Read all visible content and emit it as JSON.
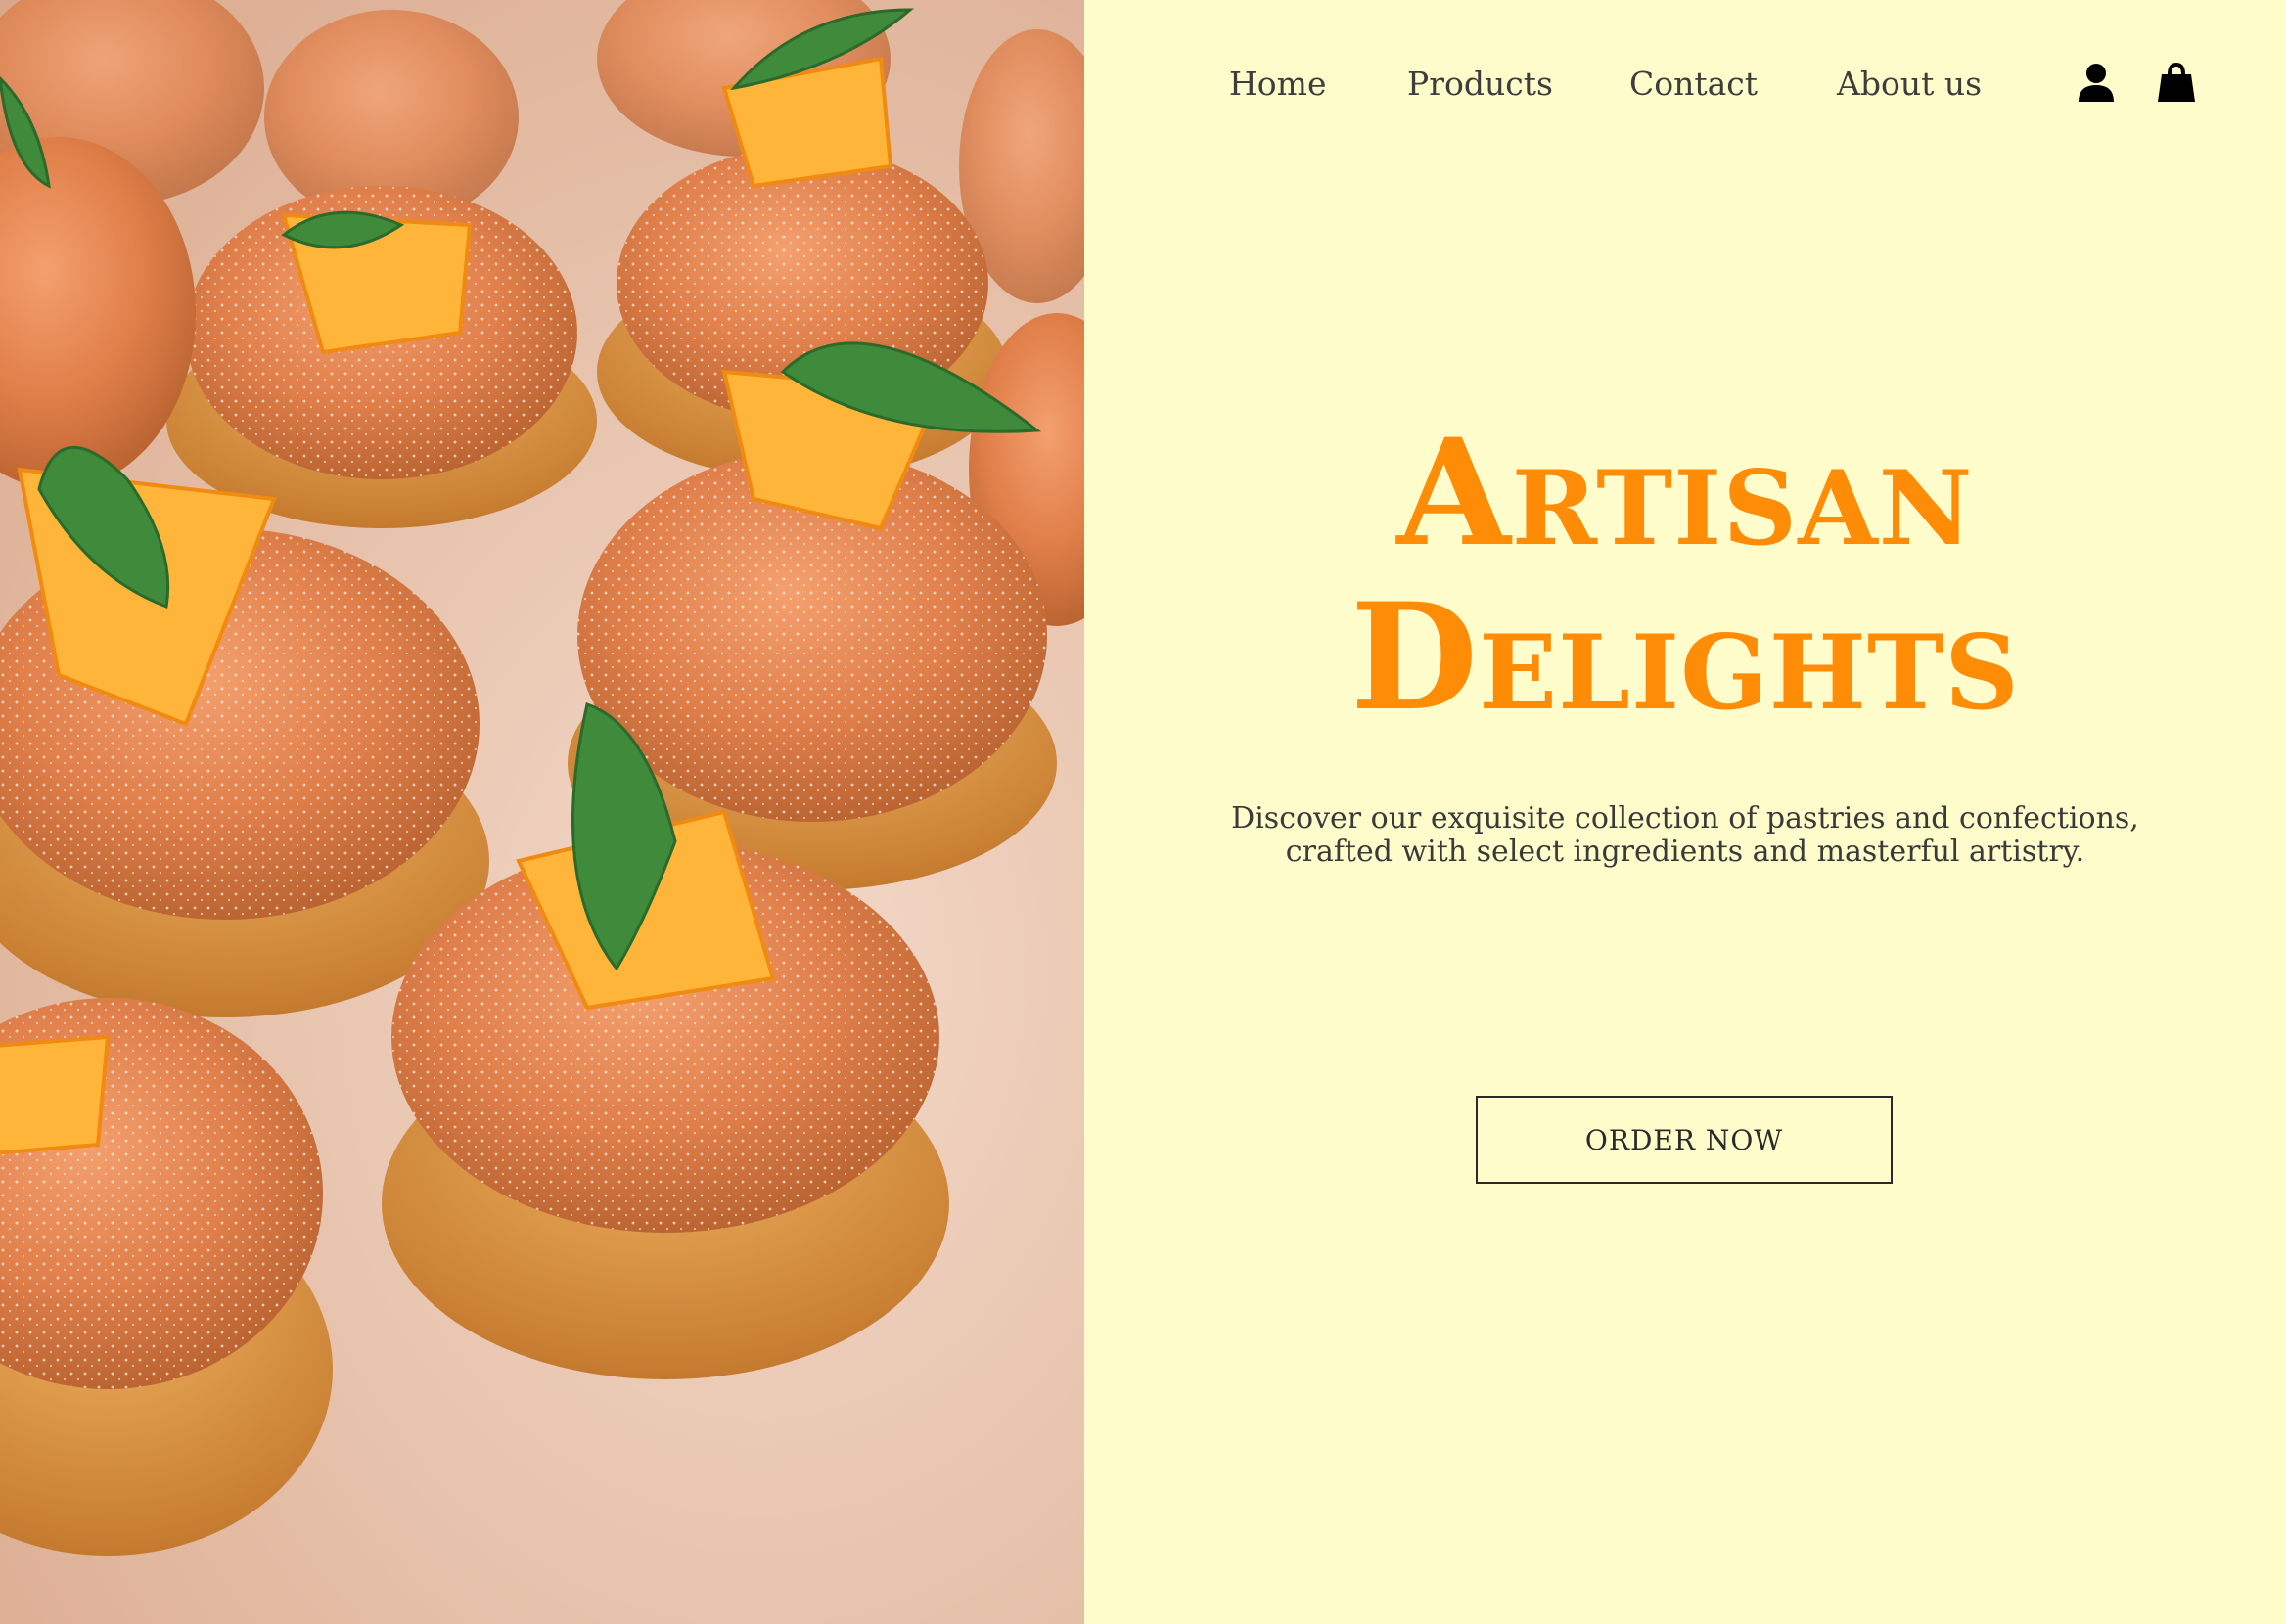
{
  "nav": {
    "home": "Home",
    "products": "Products",
    "contact": "Contact",
    "about": "About us",
    "account_icon": "user-icon",
    "cart_icon": "shopping-bag-icon"
  },
  "hero": {
    "title_line1": "Artisan",
    "title_line2": "Delights",
    "description": "Discover our exquisite collection of pastries and confections, crafted with select ingredients and masterful artistry.",
    "cta": "ORDER NOW"
  },
  "colors": {
    "background": "#fffccc",
    "accent": "#ff8c07",
    "text": "#3a3a3a"
  }
}
